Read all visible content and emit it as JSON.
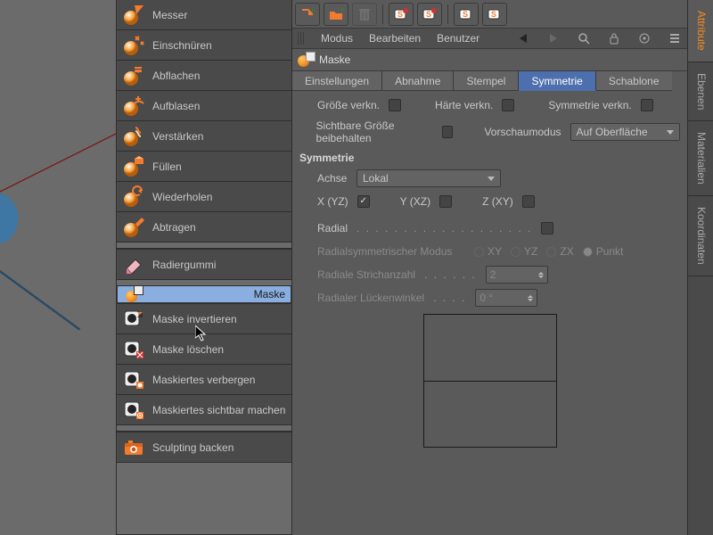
{
  "palette": {
    "tools": [
      {
        "label": "Messer",
        "icon": "knife"
      },
      {
        "label": "Einschnüren",
        "icon": "pinch"
      },
      {
        "label": "Abflachen",
        "icon": "flatten"
      },
      {
        "label": "Aufblasen",
        "icon": "inflate"
      },
      {
        "label": "Verstärken",
        "icon": "amplify"
      },
      {
        "label": "Füllen",
        "icon": "fill"
      },
      {
        "label": "Wiederholen",
        "icon": "repeat"
      },
      {
        "label": "Abtragen",
        "icon": "scrape"
      }
    ],
    "eraser": {
      "label": "Radiergummi"
    },
    "mask_tools": [
      {
        "label": "Maske",
        "selected": true
      },
      {
        "label": "Maske invertieren"
      },
      {
        "label": "Maske löschen"
      },
      {
        "label": "Maskiertes verbergen"
      },
      {
        "label": "Maskiertes sichtbar machen"
      }
    ],
    "bake": {
      "label": "Sculpting backen"
    }
  },
  "menu": {
    "items": [
      "Modus",
      "Bearbeiten",
      "Benutzer"
    ]
  },
  "object": {
    "name": "Maske"
  },
  "tabs": [
    "Einstellungen",
    "Abnahme",
    "Stempel",
    "Symmetrie",
    "Schablone"
  ],
  "active_tab": "Symmetrie",
  "check_row": {
    "a": "Größe verkn.",
    "b": "Härte verkn.",
    "c": "Symmetrie verkn."
  },
  "check_row2": {
    "a": "Sichtbare Größe beibehalten",
    "b": "Vorschaumodus"
  },
  "preview_mode": "Auf Oberfläche",
  "symmetry": {
    "header": "Symmetrie",
    "axis_label": "Achse",
    "axis_value": "Lokal",
    "ax": {
      "x": "X (YZ)",
      "y": "Y (XZ)",
      "z": "Z (XY)"
    }
  },
  "radial": {
    "label": "Radial",
    "mode": "Radialsymmetrischer Modus",
    "opts": {
      "xy": "XY",
      "yz": "YZ",
      "zx": "ZX",
      "pt": "Punkt"
    },
    "strokes_l": "Radiale Strichanzahl",
    "strokes_v": "2",
    "gap_l": "Radialer Lückenwinkel",
    "gap_v": "0 °"
  },
  "vtabs": [
    "Attribute",
    "Ebenen",
    "Materialien",
    "Koordinaten"
  ]
}
